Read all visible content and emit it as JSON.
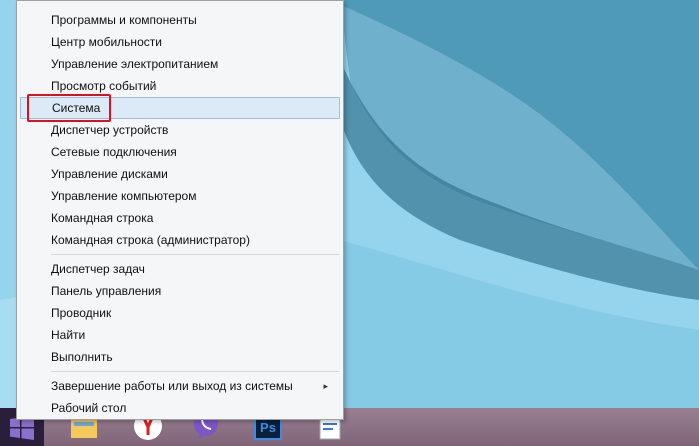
{
  "context_menu": {
    "groups": [
      [
        "Программы и компоненты",
        "Центр мобильности",
        "Управление электропитанием",
        "Просмотр событий",
        "Система",
        "Диспетчер устройств",
        "Сетевые подключения",
        "Управление дисками",
        "Управление компьютером",
        "Командная строка",
        "Командная строка (администратор)"
      ],
      [
        "Диспетчер задач",
        "Панель управления",
        "Проводник",
        "Найти",
        "Выполнить"
      ],
      [
        "Завершение работы или выход из системы",
        "Рабочий стол"
      ]
    ],
    "selected": "Система",
    "submenu_arrow": "▸"
  },
  "taskbar": {
    "icons": [
      "windows-start-icon",
      "file-explorer-icon",
      "yandex-browser-icon",
      "viber-icon",
      "photoshop-icon",
      "wordpad-icon"
    ],
    "photoshop_text": "Ps"
  },
  "colors": {
    "accent_highlight": "#e0101a",
    "selection": "#dce9f7"
  }
}
